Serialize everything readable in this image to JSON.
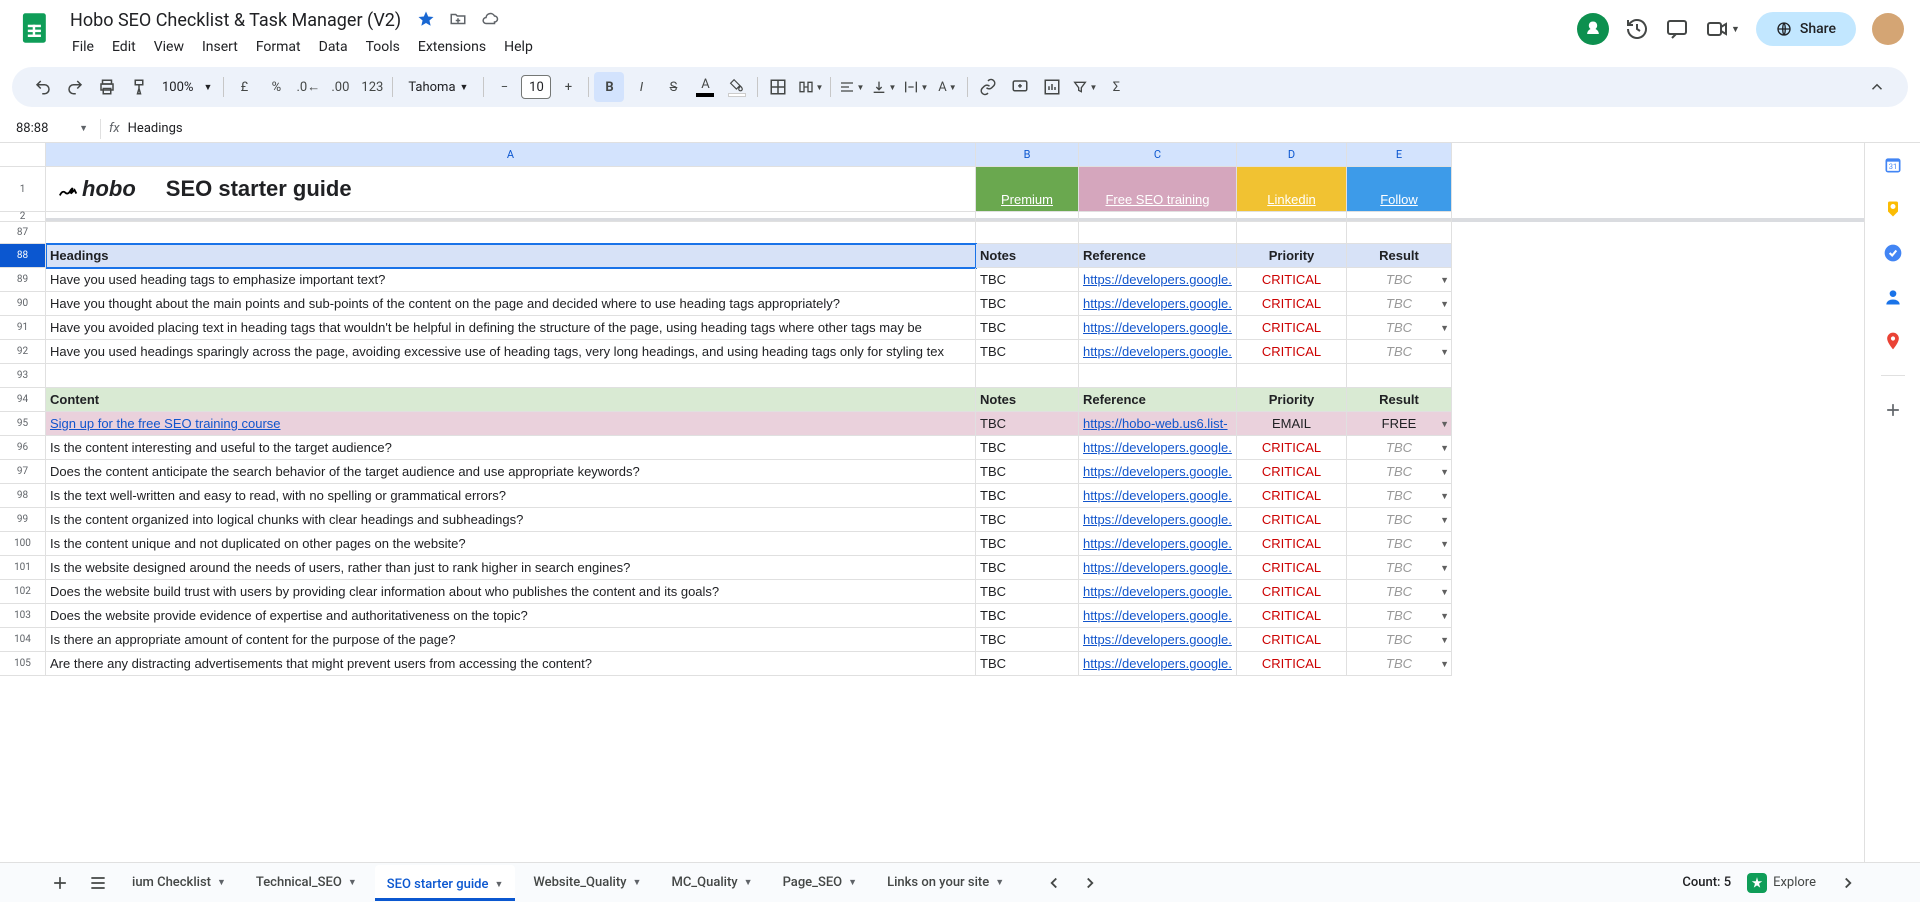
{
  "doc": {
    "title": "Hobo SEO Checklist & Task Manager (V2)"
  },
  "menus": [
    "File",
    "Edit",
    "View",
    "Insert",
    "Format",
    "Data",
    "Tools",
    "Extensions",
    "Help"
  ],
  "share": {
    "label": "Share"
  },
  "toolbar": {
    "zoom": "100%",
    "currency": "£",
    "percent": "%",
    "num_fmt": "123",
    "font": "Tahoma",
    "font_size": "10"
  },
  "name_box": "88:88",
  "fx_value": "Headings",
  "columns": [
    "A",
    "B",
    "C",
    "D",
    "E"
  ],
  "frozen": {
    "logo_text": "hobo",
    "title": "SEO starter guide",
    "links": [
      {
        "label": "Premium",
        "bg": "#6aa84f",
        "fg": "#fff"
      },
      {
        "label": "Free SEO training",
        "bg": "#d5a6bd",
        "fg": "#fff"
      },
      {
        "label": "Linkedin",
        "bg": "#f1c232",
        "fg": "#fff"
      },
      {
        "label": "Follow",
        "bg": "#3d9be9",
        "fg": "#fff"
      }
    ]
  },
  "section1": {
    "row_num": "88",
    "a": "Headings",
    "b": "Notes",
    "c": "Reference",
    "d": "Priority",
    "e": "Result"
  },
  "rows1": [
    {
      "n": "89",
      "a": "Have you used heading tags to emphasize important text?",
      "b": "TBC",
      "c": "https://developers.google.",
      "d": "CRITICAL",
      "e": "TBC"
    },
    {
      "n": "90",
      "a": "Have you thought about the main points and sub-points of the content on the page and decided where to use heading tags appropriately?",
      "b": "TBC",
      "c": "https://developers.google.",
      "d": "CRITICAL",
      "e": "TBC"
    },
    {
      "n": "91",
      "a": "Have you avoided placing text in heading tags that wouldn't be helpful in defining the structure of the page, using heading tags where other tags may be",
      "b": "TBC",
      "c": "https://developers.google.",
      "d": "CRITICAL",
      "e": "TBC"
    },
    {
      "n": "92",
      "a": "Have you used headings sparingly across the page, avoiding excessive use of heading tags, very long headings, and using heading tags only for styling tex",
      "b": "TBC",
      "c": "https://developers.google.",
      "d": "CRITICAL",
      "e": "TBC"
    }
  ],
  "empty_row": "93",
  "section2": {
    "row_num": "94",
    "a": "Content",
    "b": "Notes",
    "c": "Reference",
    "d": "Priority",
    "e": "Result"
  },
  "signup_row": {
    "n": "95",
    "a": "Sign up for the free SEO training course",
    "b": "TBC",
    "c": "https://hobo-web.us6.list-",
    "d": "EMAIL",
    "e": "FREE"
  },
  "rows2": [
    {
      "n": "96",
      "a": "Is the content interesting and useful to the target audience?",
      "b": "TBC",
      "c": "https://developers.google.",
      "d": "CRITICAL",
      "e": "TBC"
    },
    {
      "n": "97",
      "a": "Does the content anticipate the search behavior of the target audience and use appropriate keywords?",
      "b": "TBC",
      "c": "https://developers.google.",
      "d": "CRITICAL",
      "e": "TBC"
    },
    {
      "n": "98",
      "a": "Is the text well-written and easy to read, with no spelling or grammatical errors?",
      "b": "TBC",
      "c": "https://developers.google.",
      "d": "CRITICAL",
      "e": "TBC"
    },
    {
      "n": "99",
      "a": "Is the content organized into logical chunks with clear headings and subheadings?",
      "b": "TBC",
      "c": "https://developers.google.",
      "d": "CRITICAL",
      "e": "TBC"
    },
    {
      "n": "100",
      "a": "Is the content unique and not duplicated on other pages on the website?",
      "b": "TBC",
      "c": "https://developers.google.",
      "d": "CRITICAL",
      "e": "TBC"
    },
    {
      "n": "101",
      "a": "Is the website designed around the needs of users, rather than just to rank higher in search engines?",
      "b": "TBC",
      "c": "https://developers.google.",
      "d": "CRITICAL",
      "e": "TBC"
    },
    {
      "n": "102",
      "a": "Does the website build trust with users by providing clear information about who publishes the content and its goals?",
      "b": "TBC",
      "c": "https://developers.google.",
      "d": "CRITICAL",
      "e": "TBC"
    },
    {
      "n": "103",
      "a": "Does the website provide evidence of expertise and authoritativeness on the topic?",
      "b": "TBC",
      "c": "https://developers.google.",
      "d": "CRITICAL",
      "e": "TBC"
    },
    {
      "n": "104",
      "a": "Is there an appropriate amount of content for the purpose of the page?",
      "b": "TBC",
      "c": "https://developers.google.",
      "d": "CRITICAL",
      "e": "TBC"
    },
    {
      "n": "105",
      "a": "Are there any distracting advertisements that might prevent users from accessing the content?",
      "b": "TBC",
      "c": "https://developers.google.",
      "d": "CRITICAL",
      "e": "TBC"
    }
  ],
  "tabs": [
    {
      "label": "ium Checklist",
      "active": false
    },
    {
      "label": "Technical_SEO",
      "active": false
    },
    {
      "label": "SEO starter guide",
      "active": true
    },
    {
      "label": "Website_Quality",
      "active": false
    },
    {
      "label": "MC_Quality",
      "active": false
    },
    {
      "label": "Page_SEO",
      "active": false
    },
    {
      "label": "Links on your site",
      "active": false
    }
  ],
  "status": {
    "count": "Count: 5",
    "explore": "Explore"
  },
  "row_before_hdr": "87",
  "row_tiny": "2"
}
